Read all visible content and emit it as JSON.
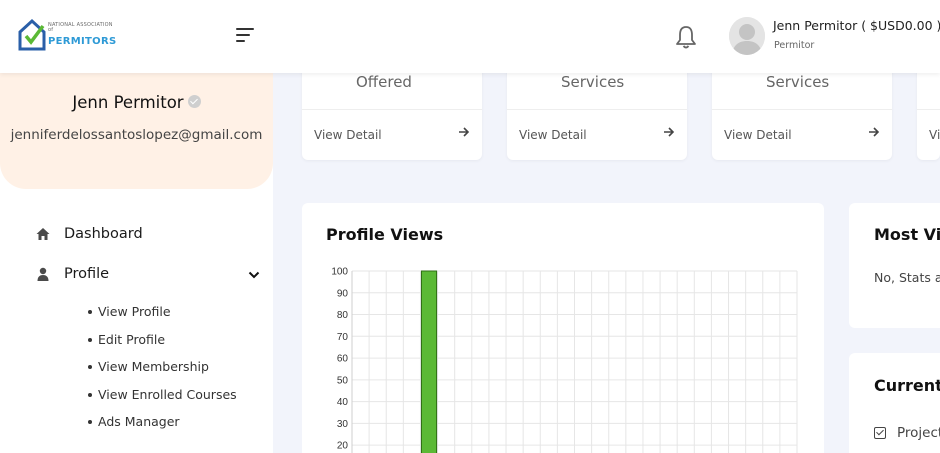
{
  "header": {
    "logo_small": "NATIONAL ASSOCIATION of",
    "logo_big": "PERMITORS",
    "user_name": "Jenn Permitor ( $USD0.00 )",
    "user_role": "Permitor"
  },
  "sidebar": {
    "profile_name": "Jenn Permitor",
    "profile_email": "jenniferdelossantoslopez@gmail.com",
    "nav": [
      {
        "label": "Dashboard",
        "icon": "home-icon"
      },
      {
        "label": "Profile",
        "icon": "user-icon"
      }
    ],
    "profile_submenu": [
      "View Profile",
      "Edit Profile",
      "View Membership",
      "View Enrolled Courses",
      "Ads Manager"
    ]
  },
  "stat_cards": [
    {
      "title": "Offered",
      "detail": "View Detail",
      "color": "#2e9ad6"
    },
    {
      "title": "Services",
      "detail": "View Detail",
      "color": "#e0344f"
    },
    {
      "title": "Services",
      "detail": "View Detail",
      "color": "#f2b705"
    },
    {
      "title": "",
      "detail": "Vi",
      "color": "#2ec4c4"
    }
  ],
  "profile_views": {
    "title": "Profile Views"
  },
  "chart_data": {
    "type": "bar",
    "title": "Profile Views",
    "ylim": [
      0,
      100
    ],
    "y_ticks": [
      100,
      90,
      80,
      70,
      60,
      50,
      40,
      30,
      20
    ],
    "series": [
      {
        "values": [
          100
        ],
        "color": "#5bb935"
      }
    ],
    "grid": true
  },
  "most_viewed": {
    "title": "Most Vie",
    "text": "No, Stats a"
  },
  "current": {
    "title": "Current",
    "item": "Project"
  },
  "colors": {
    "accent_green": "#5bb935",
    "profile_bg": "#fff1e6",
    "page_bg": "#f2f4fb"
  }
}
